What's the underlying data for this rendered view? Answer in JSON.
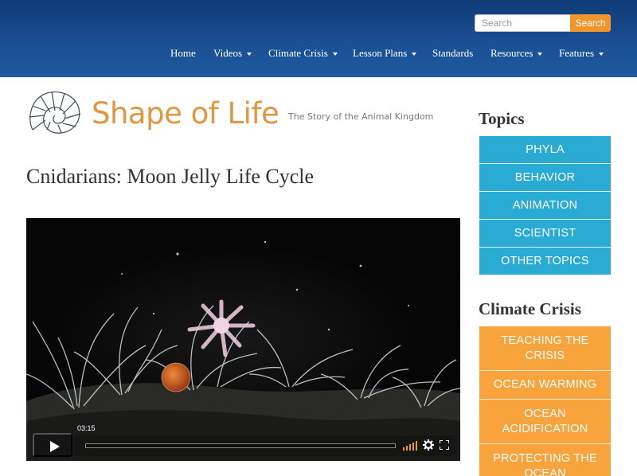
{
  "search": {
    "placeholder": "Search",
    "button_label": "Search"
  },
  "nav": {
    "items": [
      {
        "label": "Home",
        "dropdown": false
      },
      {
        "label": "Videos",
        "dropdown": true
      },
      {
        "label": "Climate Crisis",
        "dropdown": true
      },
      {
        "label": "Lesson Plans",
        "dropdown": true
      },
      {
        "label": "Standards",
        "dropdown": false
      },
      {
        "label": "Resources",
        "dropdown": true
      },
      {
        "label": "Features",
        "dropdown": true
      }
    ]
  },
  "logo": {
    "title": "Shape of Life",
    "tagline": "The Story of the Animal Kingdom",
    "icon": "nautilus-shell-icon"
  },
  "page": {
    "title": "Cnidarians: Moon Jelly Life Cycle"
  },
  "video": {
    "duration": "03:15",
    "progress": 0
  },
  "sidebar": {
    "topics_heading": "Topics",
    "topics": [
      "PHYLA",
      "BEHAVIOR",
      "ANIMATION",
      "SCIENTIST",
      "OTHER TOPICS"
    ],
    "climate_heading": "Climate Crisis",
    "climate": [
      "TEACHING THE CRISIS",
      "OCEAN WARMING",
      "OCEAN ACIDIFICATION",
      "PROTECTING THE OCEAN"
    ]
  },
  "colors": {
    "header": "#1a4f93",
    "accent_orange": "#f9a33c",
    "topic_blue": "#29abd4",
    "logo_orange": "#e2963f"
  }
}
